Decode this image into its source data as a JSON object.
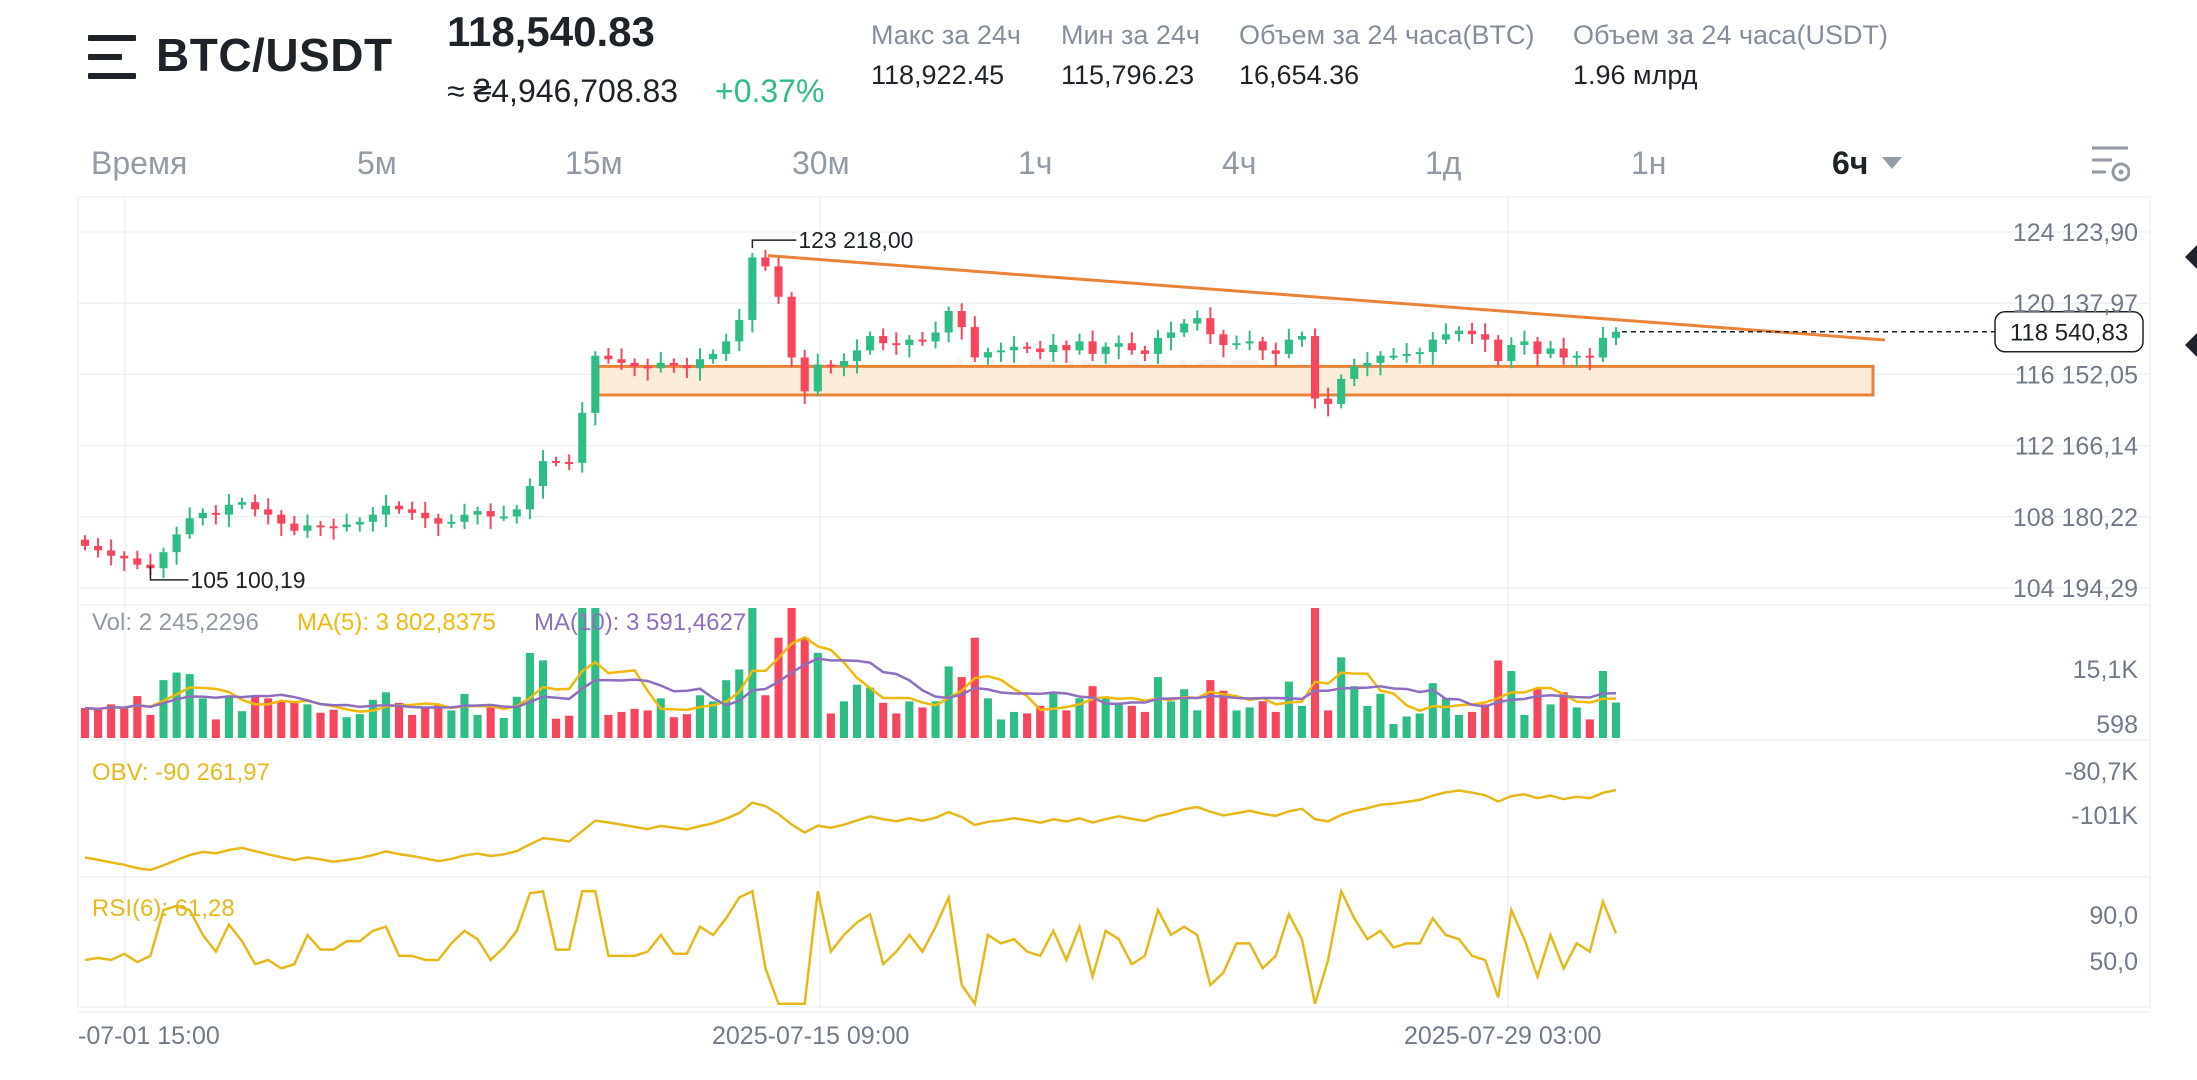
{
  "header": {
    "pair": "BTC/USDT",
    "last_price": "118,540.83",
    "approx_value": "≈ ₴4,946,708.83",
    "change_pct": "+0.37%",
    "stats": [
      {
        "label": "Макс за 24ч",
        "value": "118,922.45"
      },
      {
        "label": "Мин за 24ч",
        "value": "115,796.23"
      },
      {
        "label": "Объем за 24 часа(BTC)",
        "value": "16,654.36"
      },
      {
        "label": "Объем за 24 часа(USDT)",
        "value": "1.96 млрд"
      }
    ]
  },
  "timeframes": {
    "items": [
      "Время",
      "5м",
      "15м",
      "30м",
      "1ч",
      "4ч",
      "1д",
      "1н"
    ],
    "selected": "6ч"
  },
  "colors": {
    "up": "#2ebd85",
    "down": "#f6465d",
    "ma5": "#f0b90b",
    "ma10": "#8e6fbf",
    "indicator": "#e5b91b",
    "trendline": "#e8843a",
    "zone_fill": "#fdebd9"
  },
  "watermark": "BINANCE",
  "chart_data": {
    "type": "candlestick",
    "price_axis": {
      "ticks": [
        "124 123,90",
        "120 137,97",
        "116 152,05",
        "112 166,14",
        "108 180,22",
        "104 194,29"
      ],
      "tick_values": [
        124123.9,
        120137.97,
        116152.05,
        112166.14,
        108180.22,
        104194.29
      ],
      "current_price_label": "118 540,83",
      "current_price": 118540.83
    },
    "annotations": {
      "high_label": "123 218,00",
      "high_value": 123218.0,
      "low_label": "105 100,19",
      "low_value": 105100.19
    },
    "trendline": {
      "from_price": 122800,
      "to_price": 118080,
      "note": "descending resistance line from the high"
    },
    "support_zone": {
      "top_price": 116600,
      "bottom_price": 115000
    },
    "candles_sample_closes": [
      106550,
      106300,
      106000,
      105850,
      105500,
      105300,
      106200,
      107200,
      108100,
      108400,
      108300,
      108850,
      109000,
      108600,
      108300,
      107800,
      107400,
      107700,
      107650,
      107600,
      107750,
      107900,
      108300,
      108800,
      108600,
      108400,
      108100,
      107800,
      107900,
      108300,
      108500,
      108200,
      108200,
      108600,
      109900,
      111300,
      111250,
      111200,
      114000,
      117200,
      117000,
      116800,
      116600,
      116500,
      116800,
      116650,
      116500,
      117000,
      117300,
      118000,
      119200,
      122700,
      122200,
      120500,
      117100,
      115200,
      116700,
      116600,
      116900,
      117500,
      118300,
      117900,
      117800,
      118100,
      118000,
      118500,
      119700,
      118800,
      117100,
      117400,
      117500,
      117700,
      117600,
      117400,
      117800,
      117500,
      118000,
      117300,
      117700,
      117900,
      117500,
      117300,
      118200,
      118500,
      119000,
      119300,
      118400,
      117800,
      117900,
      118000,
      117500,
      117300,
      118100,
      118300,
      114800,
      114500,
      115900,
      116600,
      116800,
      117200,
      117200,
      117300,
      117400,
      118100,
      118400,
      118600,
      118400,
      118100,
      116900,
      117800,
      118000,
      117300,
      117600,
      117100,
      117200,
      117100,
      118200,
      118540
    ],
    "volume": {
      "label": "Vol: 2 245,2296",
      "ma5_label": "MA(5): 3 802,8375",
      "ma10_label": "MA(10): 3 591,4627",
      "ticks": [
        "15,1K",
        "598"
      ]
    },
    "obv": {
      "label": "OBV: -90 261,97",
      "ticks": [
        "-80,7K",
        "-101K"
      ]
    },
    "rsi": {
      "label": "RSI(6): 61,28",
      "ticks": [
        "90,0",
        "50,0"
      ]
    },
    "x_labels": [
      "-07-01 15:00",
      "2025-07-15 09:00",
      "2025-07-29 03:00"
    ]
  }
}
